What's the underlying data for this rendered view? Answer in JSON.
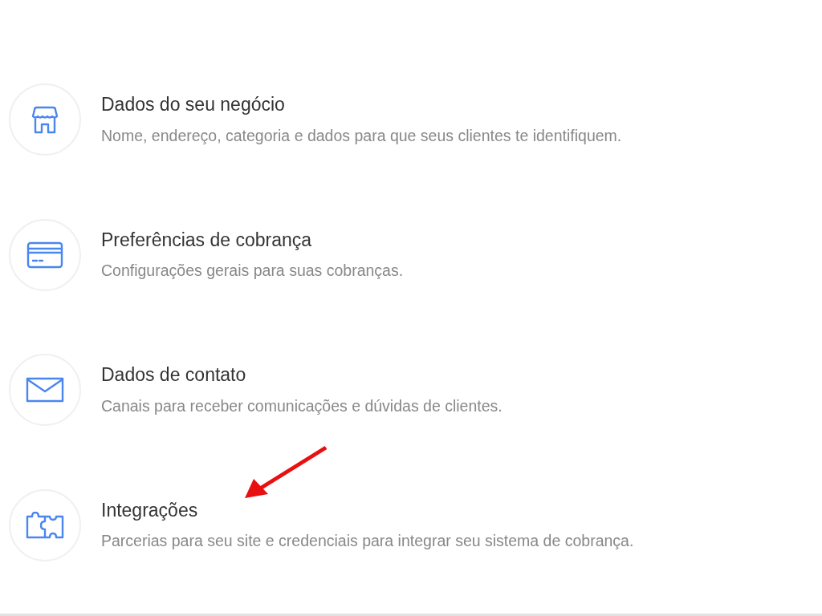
{
  "settings": [
    {
      "kind": "store",
      "title": "Dados do seu negócio",
      "description": "Nome, endereço, categoria e dados para que seus clientes te identifiquem."
    },
    {
      "kind": "card",
      "title": "Preferências de cobrança",
      "description": "Configurações gerais para suas cobranças."
    },
    {
      "kind": "mail",
      "title": "Dados de contato",
      "description": "Canais para receber comunicações e dúvidas de clientes."
    },
    {
      "kind": "puzzle",
      "title": "Integrações",
      "description": "Parcerias para seu site e credenciais para integrar seu sistema de cobrança."
    }
  ]
}
